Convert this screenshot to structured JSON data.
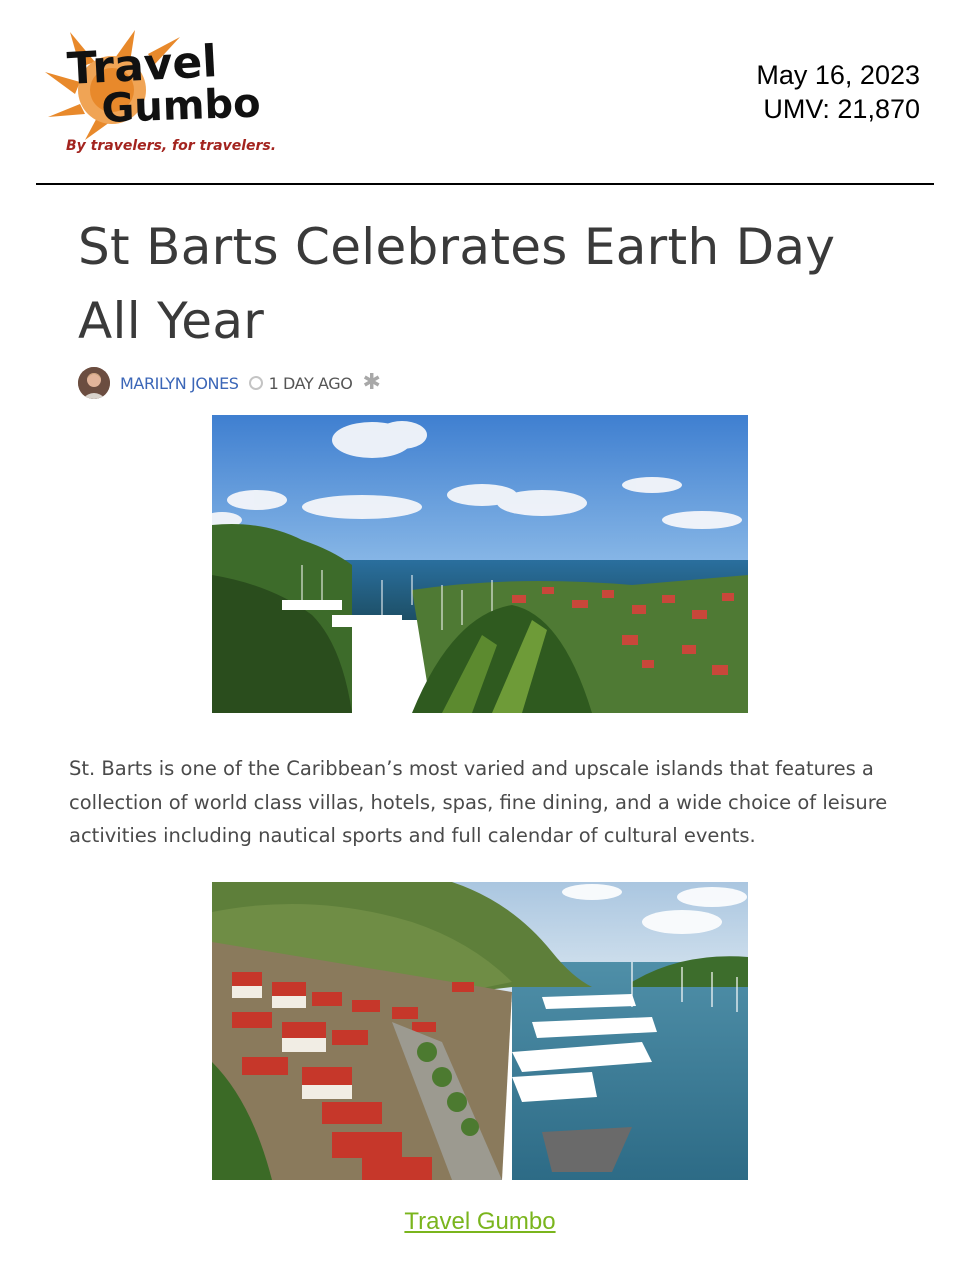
{
  "logo": {
    "line1": "Travel",
    "line2": "Gumbo",
    "tagline": "By travelers, for travelers.",
    "colors": {
      "sun": "#e8892b",
      "text": "#111111",
      "tagline": "#a3241f"
    }
  },
  "header": {
    "date": "May 16, 2023",
    "umv": "UMV: 21,870"
  },
  "article": {
    "title": "St Barts Celebrates Earth Day All Year",
    "author": "MARILYN JONES",
    "time": "1 DAY AGO",
    "body": "St. Barts is one of the Caribbean’s most varied and upscale islands that features a collection of world class villas, hotels, spas, fine dining, and a wide choice of leisure activities including nautical sports and full calendar of cultural events.",
    "photo1_icon": "harbor-photo",
    "photo2_icon": "harbor-town-photo"
  },
  "footer": {
    "link_text": "Travel Gumbo",
    "link_color": "#7ab51d"
  }
}
